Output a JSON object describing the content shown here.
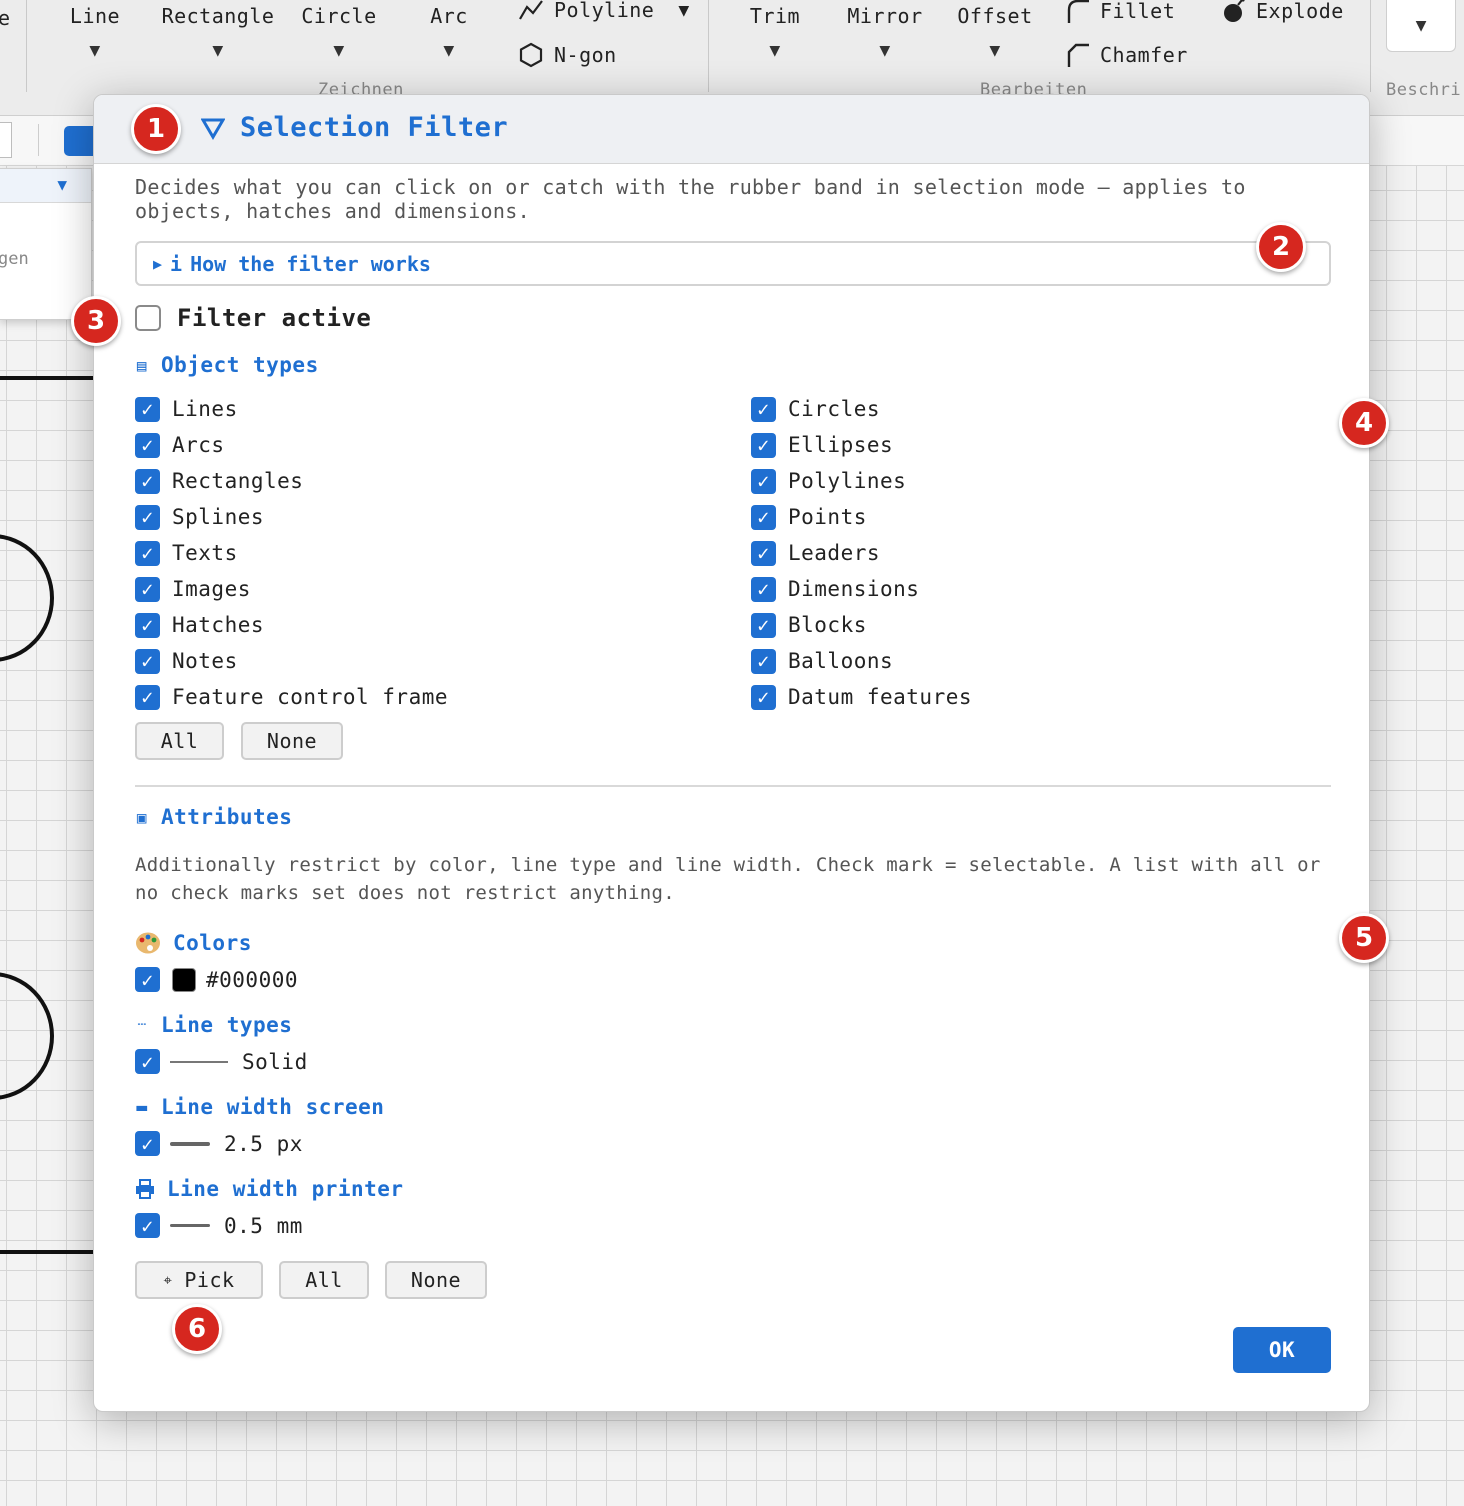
{
  "ribbon": {
    "left_fragment": "e",
    "draw_buttons": [
      "Line",
      "Rectangle",
      "Circle",
      "Arc"
    ],
    "polyline_label": "Polyline",
    "ngon_label": "N-gon",
    "draw_group_label": "Zeichnen",
    "edit_buttons": [
      "Trim",
      "Mirror",
      "Offset"
    ],
    "fillet_label": "Fillet",
    "chamfer_label": "Chamfer",
    "explode_label": "Explode",
    "edit_group_label": "Bearbeiten",
    "annotate_group_label": "Beschri"
  },
  "side_panel": {
    "text_fragment": "gen"
  },
  "dialog": {
    "title": "Selection Filter",
    "description": "Decides what you can click on or catch with the rubber band in selection mode — applies to objects, hatches and dimensions.",
    "howto_label": "How the filter works",
    "filter_active_label": "Filter active",
    "filter_active_checked": false,
    "object_types_title": "Object types",
    "object_types_left": [
      "Lines",
      "Arcs",
      "Rectangles",
      "Splines",
      "Texts",
      "Images",
      "Hatches",
      "Notes",
      "Feature control frame"
    ],
    "object_types_right": [
      "Circles",
      "Ellipses",
      "Polylines",
      "Points",
      "Leaders",
      "Dimensions",
      "Blocks",
      "Balloons",
      "Datum features"
    ],
    "all_label": "All",
    "none_label": "None",
    "attributes_title": "Attributes",
    "attributes_desc": "Additionally restrict by color, line type and line width. Check mark = selectable. A list with all or no check marks set does not restrict anything.",
    "colors_title": "Colors",
    "color_value": "#000000",
    "line_types_title": "Line types",
    "line_type_value": "Solid",
    "line_width_screen_title": "Line width screen",
    "line_width_screen_value": "2.5 px",
    "line_width_printer_title": "Line width printer",
    "line_width_printer_value": "0.5 mm",
    "pick_label": "Pick",
    "ok_label": "OK"
  },
  "badges": [
    "1",
    "2",
    "3",
    "4",
    "5",
    "6"
  ],
  "colors": {
    "accent": "#1f6fd1",
    "badge": "#d6271f"
  },
  "icons": {
    "polyline": "polyline-icon",
    "ngon": "ngon-icon",
    "fillet": "fillet-icon",
    "chamfer": "chamfer-icon",
    "explode": "explode-icon",
    "filter": "filter-icon",
    "info": "info-icon",
    "palette": "palette-icon",
    "printer": "printer-icon",
    "pick": "pick-icon"
  }
}
